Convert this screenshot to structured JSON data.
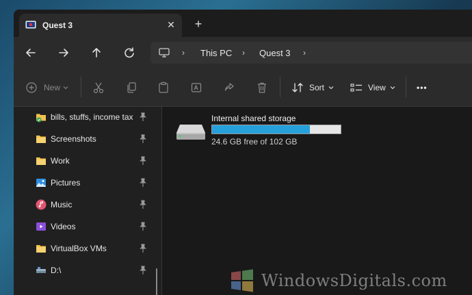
{
  "tab": {
    "title": "Quest 3",
    "close": "✕",
    "new_tab": "+"
  },
  "address": {
    "crumbs": [
      "This PC",
      "Quest 3"
    ],
    "chevron": "›"
  },
  "toolbar": {
    "new_label": "New",
    "sort_label": "Sort",
    "view_label": "View",
    "more": "•••"
  },
  "sidebar": {
    "items": [
      {
        "label": "bills, stuffs, income tax",
        "icon": "folder-sync-icon"
      },
      {
        "label": "Screenshots",
        "icon": "folder-icon"
      },
      {
        "label": "Work",
        "icon": "folder-icon"
      },
      {
        "label": "Pictures",
        "icon": "pictures-icon"
      },
      {
        "label": "Music",
        "icon": "music-icon"
      },
      {
        "label": "Videos",
        "icon": "videos-icon"
      },
      {
        "label": "VirtualBox VMs",
        "icon": "folder-icon"
      },
      {
        "label": "D:\\",
        "icon": "drive-icon"
      }
    ]
  },
  "drive": {
    "name": "Internal shared storage",
    "free_text": "24.6 GB free of 102 GB",
    "used_fraction": 0.76
  },
  "watermark": {
    "text": "WindowsDigitals.com"
  },
  "colors": {
    "accent": "#26a0da",
    "folder": "#f2c14e",
    "background": "#202020"
  }
}
